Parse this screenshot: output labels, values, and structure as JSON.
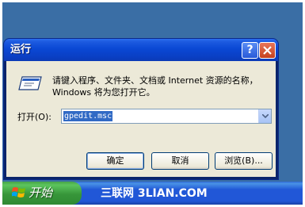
{
  "window": {
    "title": "运行",
    "help_label": "?",
    "description": "请键入程序、文件夹、文档或 Internet 资源的名称，Windows 将为您打开它。",
    "open_label": "打开(O):",
    "command_value": "gpedit.msc",
    "buttons": {
      "ok": "确定",
      "cancel": "取消",
      "browse": "浏览(B)..."
    }
  },
  "taskbar": {
    "start_label": "开始",
    "watermark": "三联网 3LIAN.COM"
  },
  "icons": {
    "help": "help-icon",
    "close": "close-icon",
    "run": "run-icon",
    "dropdown": "chevron-down-icon",
    "windows": "windows-logo-icon"
  },
  "colors": {
    "title_bar": "#0a48d4",
    "dialog_face": "#ece9d8",
    "selection": "#316ac5",
    "taskbar": "#2157d7",
    "start_button": "#3c9a3e",
    "desktop": "#3a6ea5"
  }
}
